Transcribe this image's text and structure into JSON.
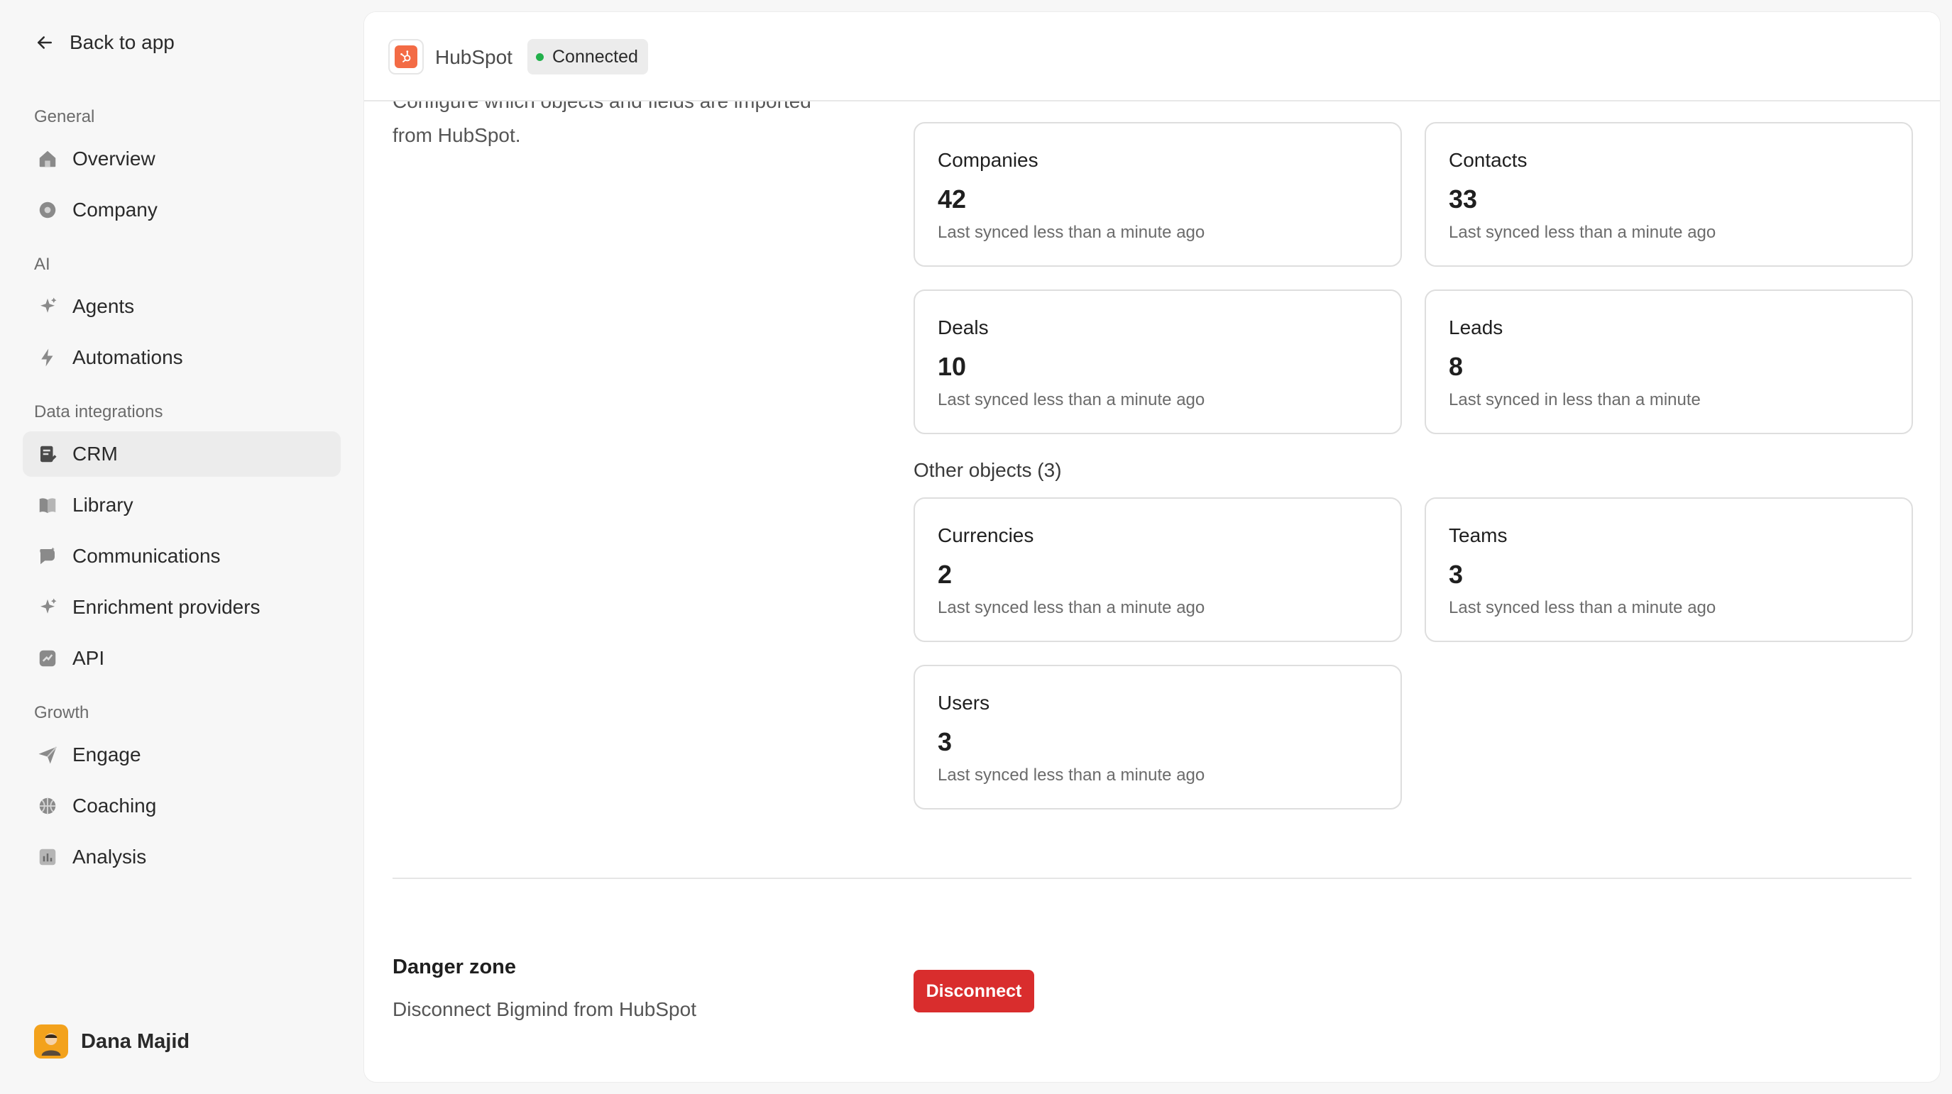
{
  "sidebar": {
    "back_label": "Back to app",
    "sections": {
      "general": "General",
      "ai": "AI",
      "data": "Data integrations",
      "growth": "Growth"
    },
    "items": {
      "overview": "Overview",
      "company": "Company",
      "agents": "Agents",
      "automations": "Automations",
      "crm": "CRM",
      "library": "Library",
      "communications": "Communications",
      "enrichment": "Enrichment providers",
      "api": "API",
      "engage": "Engage",
      "coaching": "Coaching",
      "analysis": "Analysis"
    },
    "active_item": "CRM",
    "user_name": "Dana Majid"
  },
  "header": {
    "integration_name": "HubSpot",
    "status": "Connected",
    "status_color": "#22b04b",
    "brand_color": "#f36b45"
  },
  "intro": {
    "description": "Configure which objects and fields are imported from HubSpot."
  },
  "objects": [
    {
      "name": "Companies",
      "count": "42",
      "sync": "Last synced less than a minute ago"
    },
    {
      "name": "Contacts",
      "count": "33",
      "sync": "Last synced less than a minute ago"
    },
    {
      "name": "Deals",
      "count": "10",
      "sync": "Last synced less than a minute ago"
    },
    {
      "name": "Leads",
      "count": "8",
      "sync": "Last synced in less than a minute"
    }
  ],
  "other_objects": {
    "label": "Other objects (3)",
    "items": [
      {
        "name": "Currencies",
        "count": "2",
        "sync": "Last synced less than a minute ago"
      },
      {
        "name": "Teams",
        "count": "3",
        "sync": "Last synced less than a minute ago"
      },
      {
        "name": "Users",
        "count": "3",
        "sync": "Last synced less than a minute ago"
      }
    ]
  },
  "danger_zone": {
    "title": "Danger zone",
    "description": "Disconnect Bigmind from HubSpot",
    "button_label": "Disconnect",
    "button_color": "#d92d2d"
  }
}
